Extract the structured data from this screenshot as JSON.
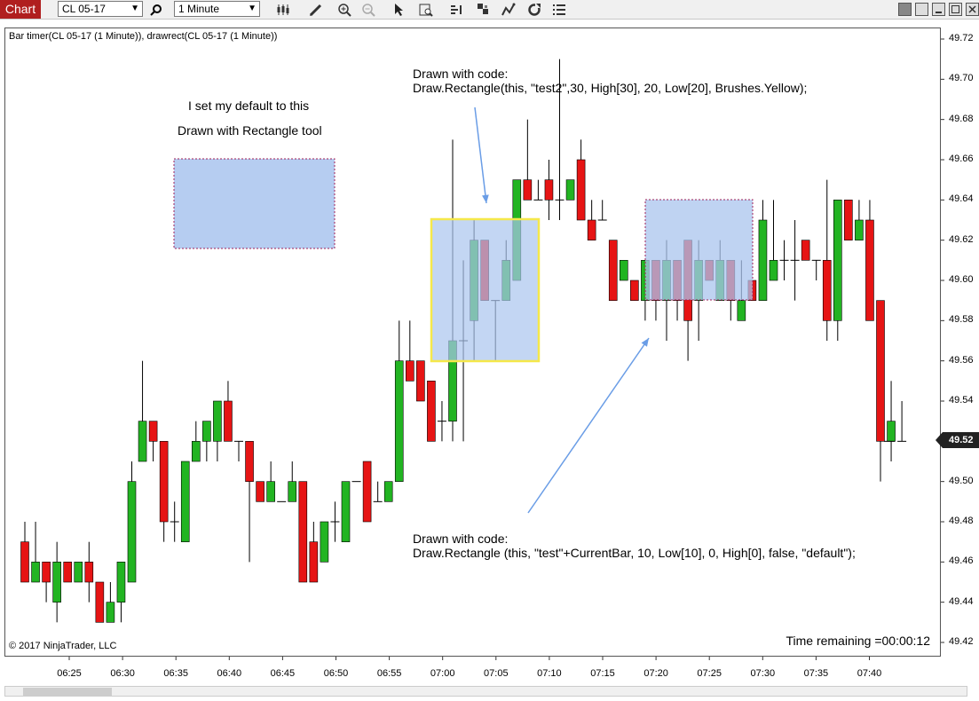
{
  "toolbar": {
    "tab_label": "Chart",
    "instrument": "CL 05-17",
    "interval": "1 Minute"
  },
  "chart": {
    "header": "Bar timer(CL 05-17 (1 Minute)), drawrect(CL 05-17 (1 Minute))",
    "copyright": "© 2017 NinjaTrader, LLC",
    "time_remaining": "Time remaining =00:00:12",
    "current_price": "49.52",
    "annotations": {
      "a1_line1": "I set my default to this",
      "a1_line2": "Drawn with Rectangle tool",
      "a2_line1": "Drawn with code:",
      "a2_line2": "Draw.Rectangle(this, \"test2\",30, High[30], 20, Low[20], Brushes.Yellow);",
      "a3_line1": "Drawn with code:",
      "a3_line2": "Draw.Rectangle (this, \"test\"+CurrentBar, 10, Low[10], 0, High[0], false, \"default\");"
    },
    "colors": {
      "up": "#22b422",
      "down": "#e61414",
      "rect_fill": "#a9c4ee",
      "yellow": "#f5e84a",
      "arrow": "#6a9de6"
    }
  },
  "chart_data": {
    "type": "candlestick",
    "price_ticks": [
      "49.72",
      "49.70",
      "49.68",
      "49.66",
      "49.64",
      "49.62",
      "49.60",
      "49.58",
      "49.56",
      "49.54",
      "49.52",
      "49.50",
      "49.48",
      "49.46",
      "49.44",
      "49.42"
    ],
    "time_ticks": [
      "06:25",
      "06:30",
      "06:35",
      "06:40",
      "06:45",
      "06:50",
      "06:55",
      "07:00",
      "07:05",
      "07:10",
      "07:15",
      "07:20",
      "07:25",
      "07:30",
      "07:35",
      "07:40"
    ],
    "ylim": [
      49.42,
      49.72
    ],
    "candles": [
      [
        49.47,
        49.45,
        49.48,
        49.45
      ],
      [
        49.45,
        49.46,
        49.48,
        49.45
      ],
      [
        49.46,
        49.45,
        49.46,
        49.44
      ],
      [
        49.44,
        49.46,
        49.47,
        49.43
      ],
      [
        49.46,
        49.45,
        49.46,
        49.45
      ],
      [
        49.45,
        49.46,
        49.46,
        49.45
      ],
      [
        49.46,
        49.45,
        49.47,
        49.44
      ],
      [
        49.45,
        49.43,
        49.45,
        49.43
      ],
      [
        49.43,
        49.44,
        49.45,
        49.43
      ],
      [
        49.44,
        49.46,
        49.46,
        49.43
      ],
      [
        49.45,
        49.5,
        49.51,
        49.45
      ],
      [
        49.51,
        49.53,
        49.56,
        49.51
      ],
      [
        49.53,
        49.52,
        49.53,
        49.51
      ],
      [
        49.52,
        49.48,
        49.52,
        49.47
      ],
      [
        49.48,
        49.48,
        49.49,
        49.47
      ],
      [
        49.47,
        49.51,
        49.51,
        49.47
      ],
      [
        49.51,
        49.52,
        49.53,
        49.51
      ],
      [
        49.52,
        49.53,
        49.53,
        49.51
      ],
      [
        49.52,
        49.54,
        49.54,
        49.51
      ],
      [
        49.54,
        49.52,
        49.55,
        49.52
      ],
      [
        49.52,
        49.52,
        49.52,
        49.51
      ],
      [
        49.52,
        49.5,
        49.52,
        49.46
      ],
      [
        49.5,
        49.49,
        49.5,
        49.49
      ],
      [
        49.49,
        49.5,
        49.51,
        49.49
      ],
      [
        49.49,
        49.49,
        49.49,
        49.49
      ],
      [
        49.49,
        49.5,
        49.51,
        49.49
      ],
      [
        49.5,
        49.45,
        49.5,
        49.45
      ],
      [
        49.47,
        49.45,
        49.48,
        49.45
      ],
      [
        49.46,
        49.48,
        49.48,
        49.46
      ],
      [
        49.48,
        49.48,
        49.49,
        49.47
      ],
      [
        49.47,
        49.5,
        49.5,
        49.47
      ],
      [
        49.5,
        49.5,
        49.5,
        49.5
      ],
      [
        49.51,
        49.48,
        49.51,
        49.48
      ],
      [
        49.49,
        49.49,
        49.5,
        49.49
      ],
      [
        49.49,
        49.5,
        49.5,
        49.49
      ],
      [
        49.5,
        49.56,
        49.58,
        49.5
      ],
      [
        49.56,
        49.55,
        49.58,
        49.55
      ],
      [
        49.56,
        49.54,
        49.56,
        49.54
      ],
      [
        49.55,
        49.52,
        49.55,
        49.52
      ],
      [
        49.53,
        49.53,
        49.54,
        49.52
      ],
      [
        49.53,
        49.57,
        49.67,
        49.52
      ],
      [
        49.57,
        49.57,
        49.61,
        49.52
      ],
      [
        49.58,
        49.62,
        49.63,
        49.56
      ],
      [
        49.62,
        49.59,
        49.62,
        49.59
      ],
      [
        49.59,
        49.59,
        49.59,
        49.56
      ],
      [
        49.59,
        49.61,
        49.62,
        49.59
      ],
      [
        49.6,
        49.65,
        49.65,
        49.6
      ],
      [
        49.65,
        49.64,
        49.68,
        49.64
      ],
      [
        49.64,
        49.64,
        49.65,
        49.64
      ],
      [
        49.65,
        49.64,
        49.66,
        49.63
      ],
      [
        49.64,
        49.64,
        49.71,
        49.63
      ],
      [
        49.64,
        49.65,
        49.65,
        49.64
      ],
      [
        49.66,
        49.63,
        49.67,
        49.63
      ],
      [
        49.63,
        49.62,
        49.64,
        49.62
      ],
      [
        49.63,
        49.63,
        49.64,
        49.63
      ],
      [
        49.62,
        49.59,
        49.62,
        49.59
      ],
      [
        49.6,
        49.61,
        49.61,
        49.6
      ],
      [
        49.6,
        49.59,
        49.6,
        49.59
      ],
      [
        49.59,
        49.61,
        49.61,
        49.58
      ],
      [
        49.61,
        49.59,
        49.61,
        49.58
      ],
      [
        49.59,
        49.61,
        49.62,
        49.57
      ],
      [
        49.61,
        49.59,
        49.61,
        49.58
      ],
      [
        49.62,
        49.58,
        49.62,
        49.56
      ],
      [
        49.59,
        49.61,
        49.62,
        49.57
      ],
      [
        49.61,
        49.6,
        49.61,
        49.6
      ],
      [
        49.59,
        49.61,
        49.62,
        49.59
      ],
      [
        49.61,
        49.59,
        49.61,
        49.58
      ],
      [
        49.58,
        49.59,
        49.61,
        49.58
      ],
      [
        49.6,
        49.59,
        49.6,
        49.59
      ],
      [
        49.59,
        49.63,
        49.64,
        49.59
      ],
      [
        49.6,
        49.61,
        49.64,
        49.6
      ],
      [
        49.61,
        49.61,
        49.62,
        49.6
      ],
      [
        49.61,
        49.61,
        49.63,
        49.59
      ],
      [
        49.62,
        49.61,
        49.62,
        49.61
      ],
      [
        49.61,
        49.61,
        49.61,
        49.6
      ],
      [
        49.61,
        49.58,
        49.65,
        49.57
      ],
      [
        49.58,
        49.64,
        49.64,
        49.57
      ],
      [
        49.64,
        49.62,
        49.64,
        49.62
      ],
      [
        49.62,
        49.63,
        49.64,
        49.62
      ],
      [
        49.63,
        49.58,
        49.64,
        49.58
      ],
      [
        49.59,
        49.52,
        49.59,
        49.5
      ],
      [
        49.52,
        49.53,
        49.55,
        49.51
      ],
      [
        49.52,
        49.52,
        49.54,
        49.52
      ]
    ]
  }
}
